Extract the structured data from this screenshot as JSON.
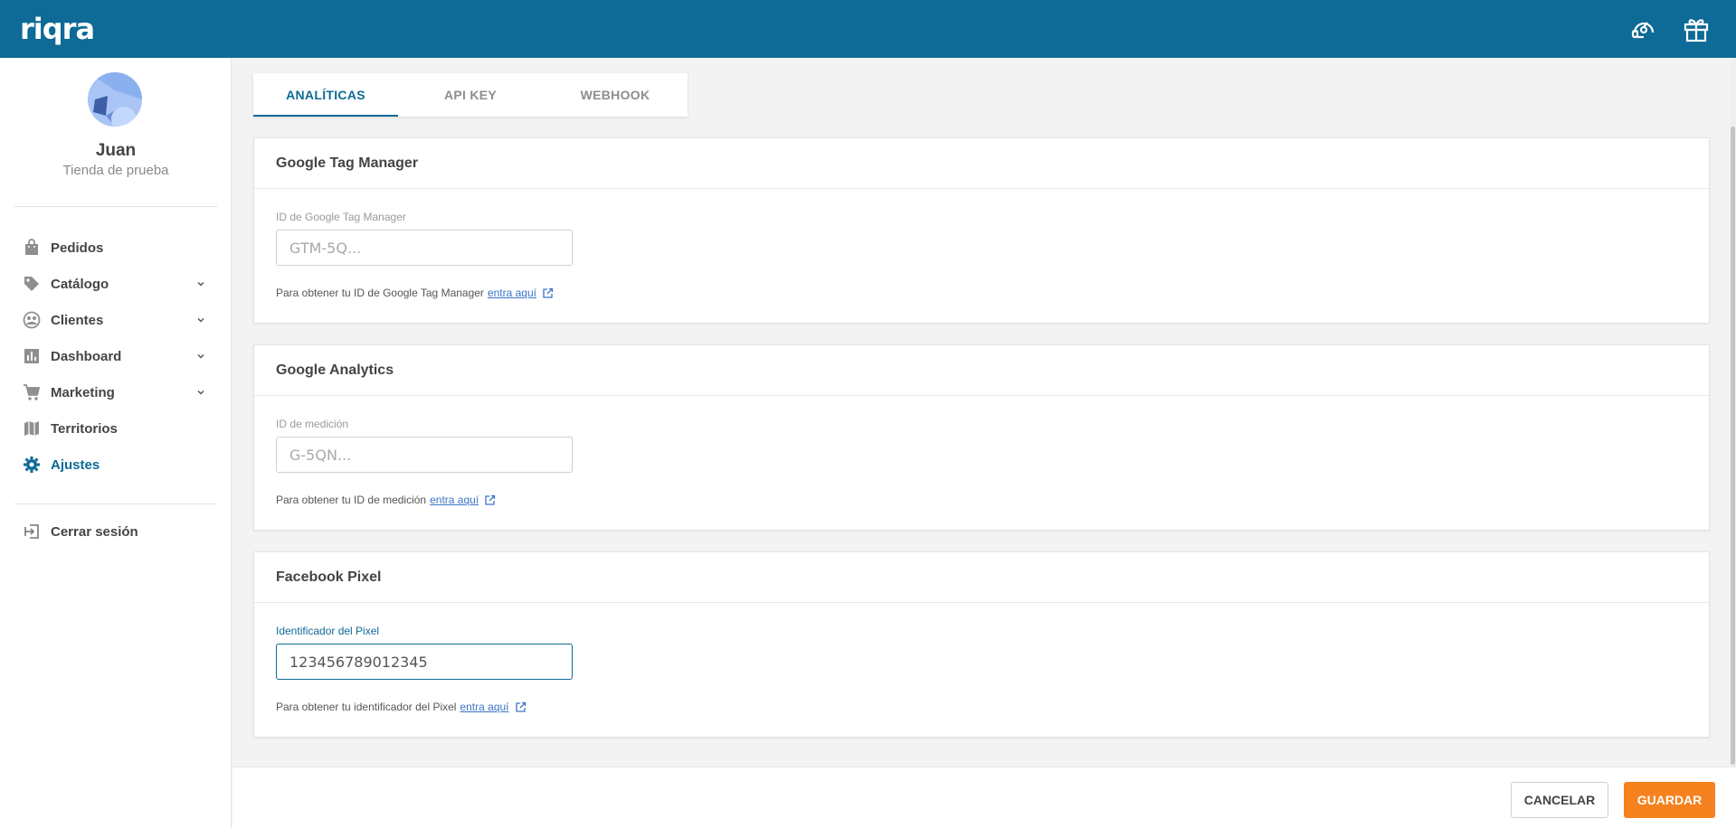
{
  "header": {
    "logo": "riqra",
    "icons": [
      "support-icon",
      "gift-icon"
    ],
    "bg_color": "#0e6a96"
  },
  "user": {
    "name": "Juan",
    "store": "Tienda de prueba"
  },
  "sidebar": {
    "items": [
      {
        "label": "Pedidos",
        "icon": "shopping-bag-icon",
        "has_chevron": false,
        "active": false
      },
      {
        "label": "Catálogo",
        "icon": "tag-icon",
        "has_chevron": true,
        "active": false
      },
      {
        "label": "Clientes",
        "icon": "clients-icon",
        "has_chevron": true,
        "active": false
      },
      {
        "label": "Dashboard",
        "icon": "bar-chart-icon",
        "has_chevron": true,
        "active": false
      },
      {
        "label": "Marketing",
        "icon": "cart-icon",
        "has_chevron": true,
        "active": false
      },
      {
        "label": "Territorios",
        "icon": "map-icon",
        "has_chevron": false,
        "active": false
      },
      {
        "label": "Ajustes",
        "icon": "gear-icon",
        "has_chevron": false,
        "active": true
      }
    ],
    "logout_label": "Cerrar sesión"
  },
  "tabs": [
    {
      "label": "ANALÍTICAS",
      "active": true
    },
    {
      "label": "API KEY",
      "active": false
    },
    {
      "label": "WEBHOOK",
      "active": false
    }
  ],
  "cards": {
    "gtm": {
      "title": "Google Tag Manager",
      "field_label": "ID de Google Tag Manager",
      "placeholder": "GTM-5Q...",
      "value": "",
      "help_text": "Para obtener tu ID de Google Tag Manager",
      "link_text": "entra aquí"
    },
    "ga": {
      "title": "Google Analytics",
      "field_label": "ID de medición",
      "placeholder": "G-5QN...",
      "value": "",
      "help_text": "Para obtener tu ID de medición",
      "link_text": "entra aquí"
    },
    "fb": {
      "title": "Facebook Pixel",
      "field_label": "Identificador del Pixel",
      "placeholder": "",
      "value": "123456789012345",
      "help_text": "Para obtener tu identificador del Pixel",
      "link_text": "entra aquí"
    }
  },
  "footer": {
    "cancel_label": "CANCELAR",
    "save_label": "GUARDAR",
    "accent_color": "#f5821f"
  }
}
